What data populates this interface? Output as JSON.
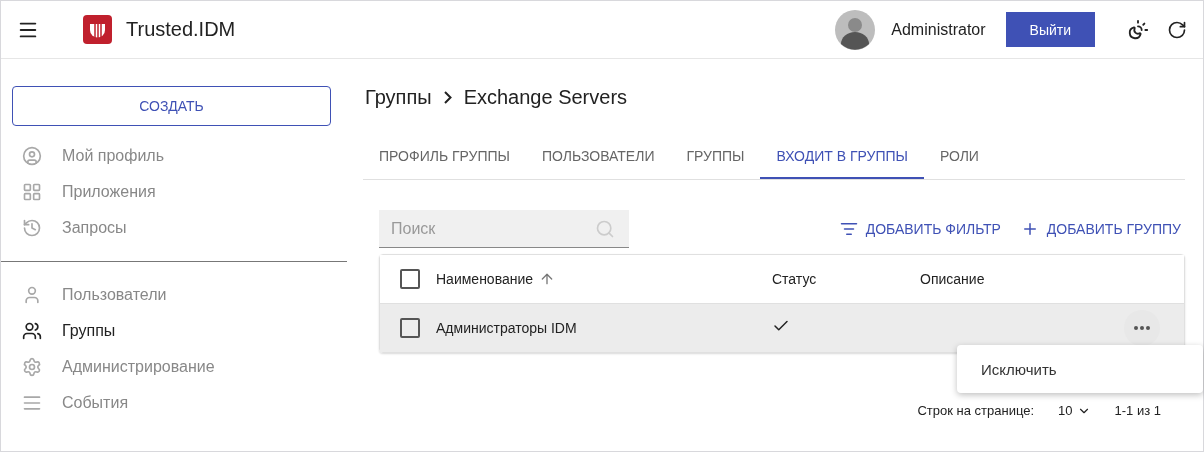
{
  "header": {
    "app_title": "Trusted.IDM",
    "user_name": "Administrator",
    "logout_button": "Выйти"
  },
  "sidebar": {
    "create_button": "СОЗДАТЬ",
    "sections": [
      {
        "items": [
          {
            "label": "Мой профиль",
            "selected": false
          },
          {
            "label": "Приложения",
            "selected": false
          },
          {
            "label": "Запросы",
            "selected": false
          }
        ]
      },
      {
        "items": [
          {
            "label": "Пользователи",
            "selected": false
          },
          {
            "label": "Группы",
            "selected": true
          },
          {
            "label": "Администрирование",
            "selected": false
          },
          {
            "label": "События",
            "selected": false
          }
        ]
      }
    ]
  },
  "breadcrumb": [
    "Группы",
    "Exchange Servers"
  ],
  "tabs": [
    {
      "label": "ПРОФИЛЬ ГРУППЫ",
      "selected": false
    },
    {
      "label": "ПОЛЬЗОВАТЕЛИ",
      "selected": false
    },
    {
      "label": "ГРУППЫ",
      "selected": false
    },
    {
      "label": "ВХОДИТ В ГРУППЫ",
      "selected": true
    },
    {
      "label": "РОЛИ",
      "selected": false
    }
  ],
  "search": {
    "placeholder": "Поиск"
  },
  "actions": [
    {
      "label": "ДОБАВИТЬ ФИЛЬТР",
      "kind": "filter"
    },
    {
      "label": "ДОБАВИТЬ ГРУППУ",
      "kind": "add"
    }
  ],
  "table": {
    "select_all_checked": false,
    "columns": [
      "Наименование",
      "Статус",
      "Описание"
    ],
    "rows": [
      {
        "name": "Администраторы IDM",
        "status_active": true,
        "checked": false,
        "hovered": true
      }
    ]
  },
  "context_menu": {
    "items": [
      "Исключить"
    ]
  },
  "pagination": {
    "rows_per_page_label": "Строк на странице:",
    "rows_per_page": "10",
    "range": "1-1 из 1"
  }
}
